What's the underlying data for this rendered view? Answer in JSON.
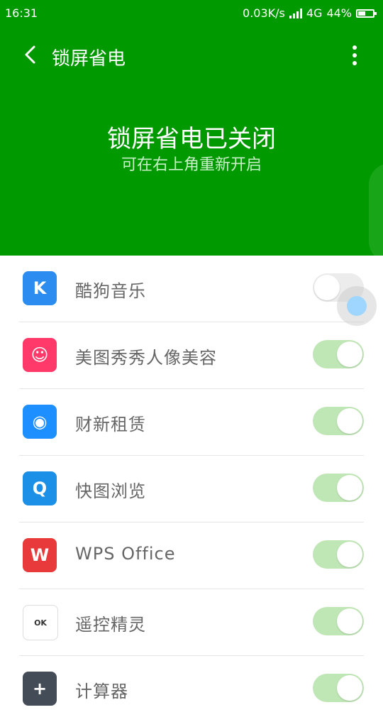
{
  "status_bar": {
    "time": "16:31",
    "speed": "0.03K/s",
    "network": "4G",
    "battery": "44%"
  },
  "nav": {
    "title": "锁屏省电",
    "back_icon": "back-arrow-icon",
    "more_icon": "more-vert-icon"
  },
  "hero": {
    "heading": "锁屏省电已关闭",
    "subheading": "可在右上角重新开启"
  },
  "apps": [
    {
      "name": "酷狗音乐",
      "enabled": false,
      "icon": "kugou-icon",
      "color": "#2d8cf0",
      "glyph": "K"
    },
    {
      "name": "美图秀秀人像美容",
      "enabled": true,
      "icon": "meitu-icon",
      "color": "#ff3a6a",
      "glyph": "☺"
    },
    {
      "name": "财新租赁",
      "enabled": true,
      "icon": "caixin-icon",
      "color": "#1e8fff",
      "glyph": "◉"
    },
    {
      "name": "快图浏览",
      "enabled": true,
      "icon": "quickpic-icon",
      "color": "#1c8fe6",
      "glyph": "Q"
    },
    {
      "name": "WPS  Office",
      "enabled": true,
      "icon": "wps-icon",
      "color": "#e83a3a",
      "glyph": "W"
    },
    {
      "name": "遥控精灵",
      "enabled": true,
      "icon": "remote-icon",
      "color": "#ffffff",
      "glyph": "OK"
    },
    {
      "name": "计算器",
      "enabled": true,
      "icon": "calculator-icon",
      "color": "#444c57",
      "glyph": "+"
    }
  ]
}
